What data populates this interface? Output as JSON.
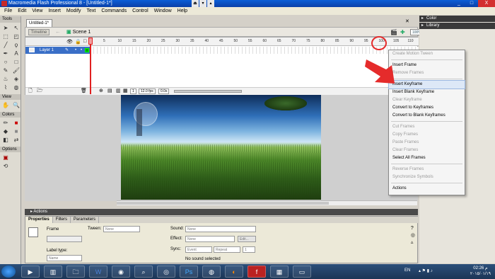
{
  "window": {
    "title": "Macromedia Flash Professional 8 - [Untitled-1*]",
    "controls": [
      "_",
      "□",
      "X"
    ]
  },
  "menubar": [
    "File",
    "Edit",
    "View",
    "Insert",
    "Modify",
    "Text",
    "Commands",
    "Control",
    "Window",
    "Help"
  ],
  "tools": {
    "title": "Tools",
    "view_title": "View",
    "colors_title": "Colors",
    "options_title": "Options"
  },
  "document": {
    "tab": "Untitled-1*",
    "timeline_button": "Timeline",
    "scene": "Scene 1",
    "zoom": "100%"
  },
  "timeline": {
    "layer_name": "Layer 1",
    "ruler_marks": [
      "5",
      "10",
      "15",
      "20",
      "25",
      "30",
      "35",
      "40",
      "45",
      "50",
      "55",
      "60",
      "65",
      "70",
      "75",
      "80",
      "85",
      "90",
      "95",
      "100",
      "105",
      "110"
    ],
    "current_frame": "1",
    "fps": "12.0 fps",
    "elapsed": "0.0s"
  },
  "panels": {
    "actions": "Actions",
    "right": [
      "Color",
      "Library"
    ]
  },
  "properties": {
    "tabs": [
      "Properties",
      "Filters",
      "Parameters"
    ],
    "frame_label": "Frame",
    "tween_label": "Tween:",
    "tween_value": "None",
    "sound_label": "Sound:",
    "sound_value": "None",
    "effect_label": "Effect:",
    "effect_value": "None",
    "edit_button": "Edit...",
    "sync_label": "Sync:",
    "sync_value": "Event",
    "repeat_value": "Repeat",
    "repeat_count": "1",
    "no_sound": "No sound selected",
    "label_type_label": "Label type:",
    "label_type_value": "Name"
  },
  "context_menu": [
    {
      "label": "Create Motion Tween",
      "disabled": true
    },
    {
      "sep": true
    },
    {
      "label": "Insert Frame",
      "disabled": false
    },
    {
      "label": "Remove Frames",
      "disabled": true
    },
    {
      "sep": true
    },
    {
      "label": "Insert Keyframe",
      "disabled": false,
      "active": true
    },
    {
      "label": "Insert Blank Keyframe",
      "disabled": false
    },
    {
      "label": "Clear Keyframe",
      "disabled": true
    },
    {
      "label": "Convert to Keyframes",
      "disabled": false
    },
    {
      "label": "Convert to Blank Keyframes",
      "disabled": false
    },
    {
      "sep": true
    },
    {
      "label": "Cut Frames",
      "disabled": true
    },
    {
      "label": "Copy Frames",
      "disabled": true
    },
    {
      "label": "Paste Frames",
      "disabled": true
    },
    {
      "label": "Clear Frames",
      "disabled": true
    },
    {
      "label": "Select All Frames",
      "disabled": false
    },
    {
      "sep": true
    },
    {
      "label": "Reverse Frames",
      "disabled": true
    },
    {
      "label": "Synchronize Symbols",
      "disabled": true
    },
    {
      "sep": true
    },
    {
      "label": "Actions",
      "disabled": false
    }
  ],
  "taskbar": {
    "language": "EN",
    "time": "02:26 م",
    "date": "٢٠١٥/٠١/١٩"
  },
  "colors": {
    "accent_red": "#e52b2b",
    "titlebar_blue": "#0a3fa8",
    "layer_selected": "#3a6fc7"
  }
}
